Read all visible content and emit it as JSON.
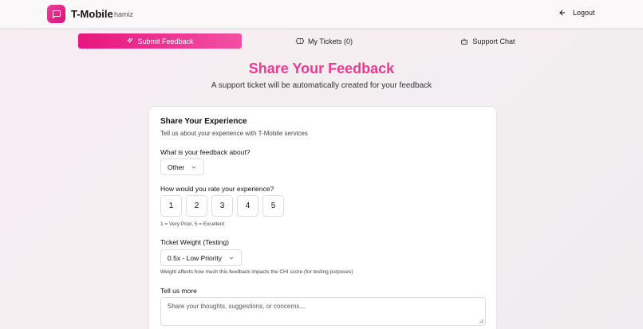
{
  "header": {
    "brand": "T-Mobile",
    "username": "hamiz",
    "logout_label": "Logout",
    "logo_icon": "message-square-icon",
    "logout_icon": "arrow-left-icon"
  },
  "tabs": [
    {
      "label": "Submit Feedback",
      "icon": "sparkles-icon",
      "active": true
    },
    {
      "label": "My Tickets (0)",
      "icon": "ticket-icon",
      "active": false
    },
    {
      "label": "Support Chat",
      "icon": "bot-icon",
      "active": false
    }
  ],
  "page": {
    "title": "Share Your Feedback",
    "subtitle": "A support ticket will be automatically created for your feedback"
  },
  "form": {
    "title": "Share Your Experience",
    "description": "Tell us about your experience with T-Mobile services",
    "topic_label": "What is your feedback about?",
    "topic_value": "Other",
    "rating_label": "How would you rate your experience?",
    "rating_options": [
      "1",
      "2",
      "3",
      "4",
      "5"
    ],
    "rating_hint": "1 = Very Poor, 5 = Excellent",
    "weight_label": "Ticket Weight (Testing)",
    "weight_value": "0.5x - Low Priority",
    "weight_hint": "Weight affects how much this feedback impacts the CHI score (for testing purposes)",
    "more_label": "Tell us more",
    "more_placeholder": "Share your thoughts, suggestions, or concerns..."
  },
  "colors": {
    "accent": "#e6167f",
    "title_pink": "#e93b93"
  }
}
